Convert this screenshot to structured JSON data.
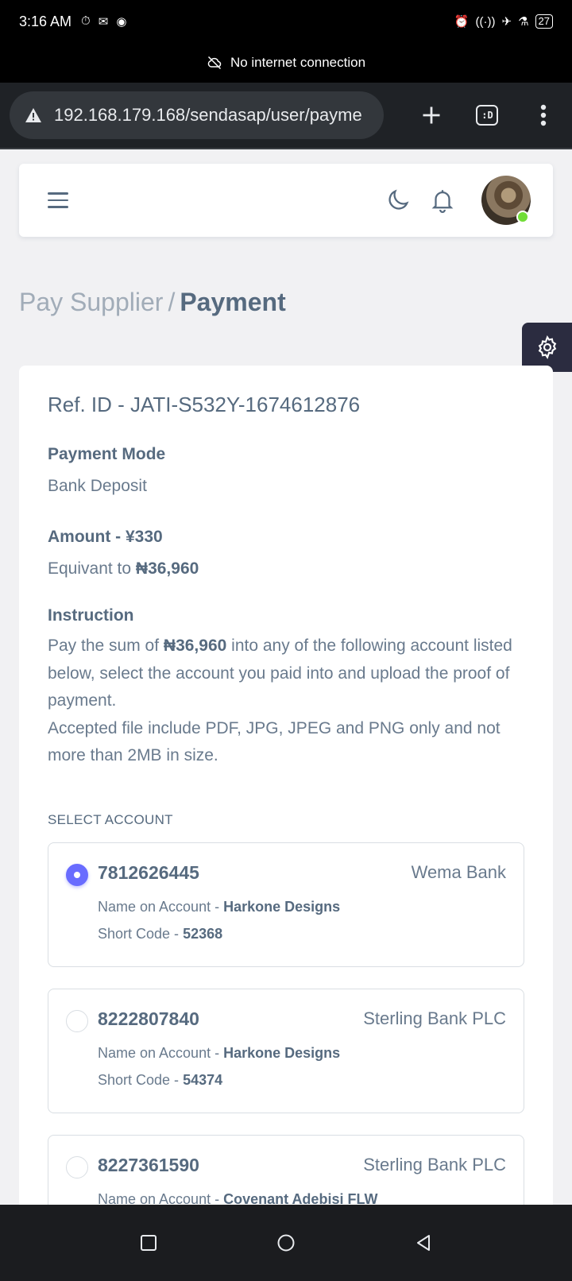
{
  "status_bar": {
    "time": "3:16 AM",
    "battery": "27"
  },
  "network_banner": {
    "text": "No internet connection"
  },
  "browser": {
    "url": "192.168.179.168/sendasap/user/payme",
    "tab_label": ":D"
  },
  "breadcrumb": {
    "parent": "Pay Supplier",
    "separator": "/",
    "current": "Payment"
  },
  "payment": {
    "ref_id": "Ref. ID - JATI-S532Y-1674612876",
    "mode_label": "Payment Mode",
    "mode_value": "Bank Deposit",
    "amount_label": "Amount - ¥330",
    "equiv_prefix": "Equivant to ",
    "equiv_value": "₦36,960",
    "instruction_label": "Instruction",
    "instruction_prefix": "Pay the sum of ",
    "instruction_amount": "₦36,960",
    "instruction_suffix": " into any of the following account listed below, select the account you paid into and upload the proof of payment.",
    "instruction_files": "Accepted file include PDF, JPG, JPEG and PNG only and not more than 2MB in size.",
    "select_account_label": "SELECT ACCOUNT"
  },
  "accounts": [
    {
      "number": "7812626445",
      "bank": "Wema Bank",
      "name_prefix": "Name on Account - ",
      "name": "Harkone Designs",
      "code_prefix": "Short Code - ",
      "code": "52368",
      "selected": true
    },
    {
      "number": "8222807840",
      "bank": "Sterling Bank PLC",
      "name_prefix": "Name on Account - ",
      "name": "Harkone Designs",
      "code_prefix": "Short Code - ",
      "code": "54374",
      "selected": false
    },
    {
      "number": "8227361590",
      "bank": "Sterling Bank PLC",
      "name_prefix": "Name on Account - ",
      "name": "Covenant Adebisi FLW",
      "code_prefix": "Short Code - ",
      "code": "",
      "selected": false
    }
  ],
  "colors": {
    "primary": "#696cff",
    "text": "#566a7f",
    "muted": "#a1acb8",
    "online": "#71dd37"
  }
}
